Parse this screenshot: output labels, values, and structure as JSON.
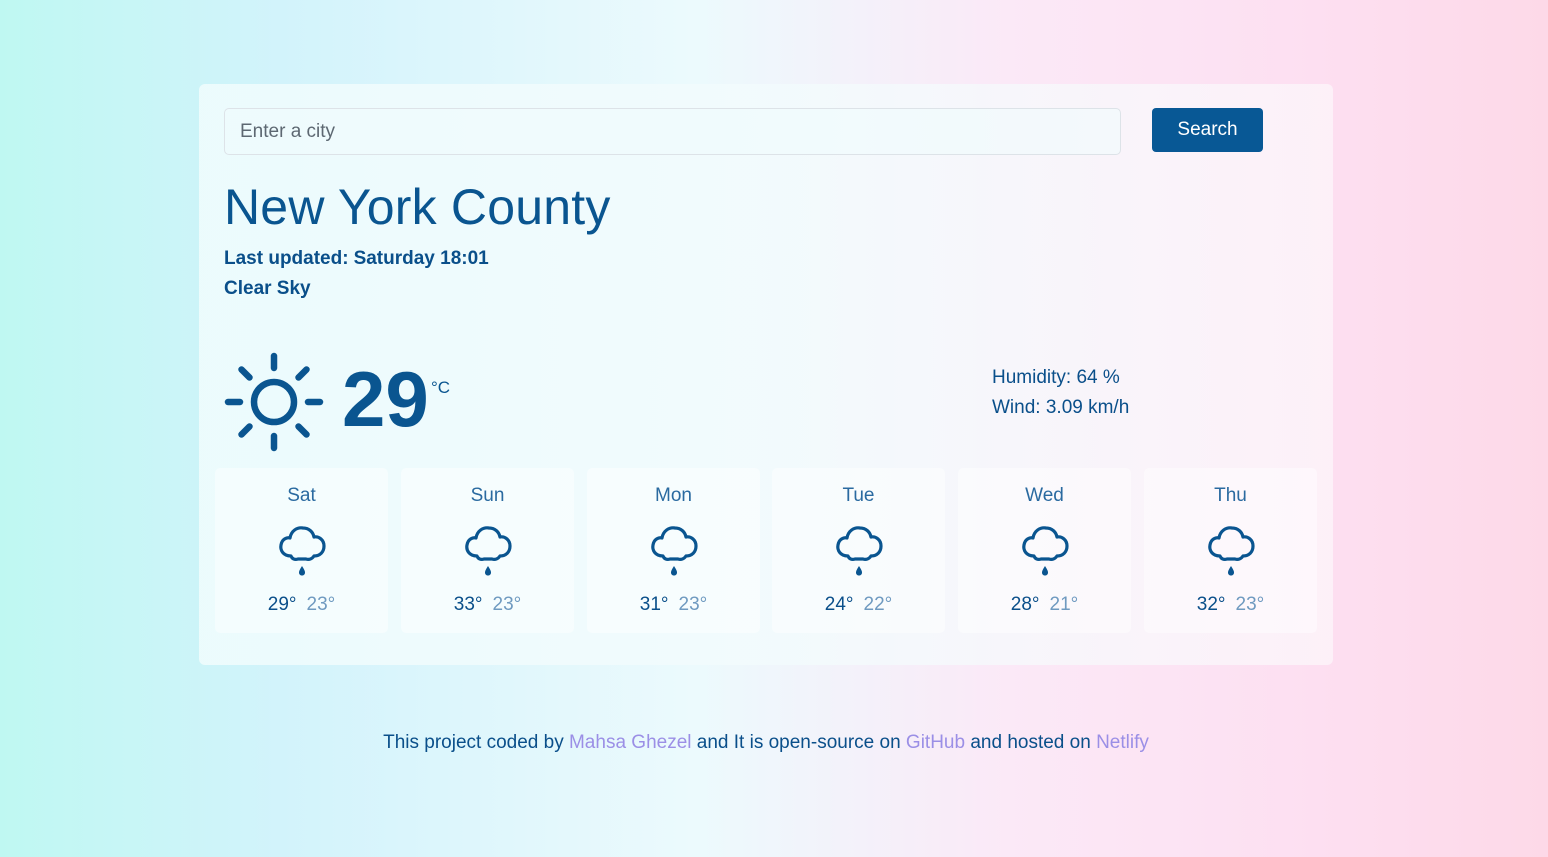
{
  "search": {
    "placeholder": "Enter a city",
    "button_label": "Search"
  },
  "current": {
    "city": "New York County",
    "last_updated_label": "Last updated:",
    "last_updated_value": "Saturday 18:01",
    "description": "Clear Sky",
    "icon": "sun-icon",
    "temperature": "29",
    "unit": "°C",
    "humidity": "Humidity: 64 %",
    "wind": "Wind: 3.09 km/h"
  },
  "forecast": [
    {
      "day": "Sat",
      "icon": "rain-cloud-icon",
      "max": "29°",
      "min": "23°"
    },
    {
      "day": "Sun",
      "icon": "rain-cloud-icon",
      "max": "33°",
      "min": "23°"
    },
    {
      "day": "Mon",
      "icon": "rain-cloud-icon",
      "max": "31°",
      "min": "23°"
    },
    {
      "day": "Tue",
      "icon": "rain-cloud-icon",
      "max": "24°",
      "min": "22°"
    },
    {
      "day": "Wed",
      "icon": "rain-cloud-icon",
      "max": "28°",
      "min": "21°"
    },
    {
      "day": "Thu",
      "icon": "rain-cloud-icon",
      "max": "32°",
      "min": "23°"
    }
  ],
  "footer": {
    "text_1": "This project coded by",
    "author_link": "Mahsa Ghezel",
    "text_2": "and It is open-source on",
    "github_link": "GitHub",
    "text_3": "and hosted on",
    "netlify_link": "Netlify"
  },
  "colors": {
    "primary": "#085895",
    "text": "#0a4f8a",
    "link": "#9b8fe6",
    "min_temp": "#6f9ac0"
  }
}
